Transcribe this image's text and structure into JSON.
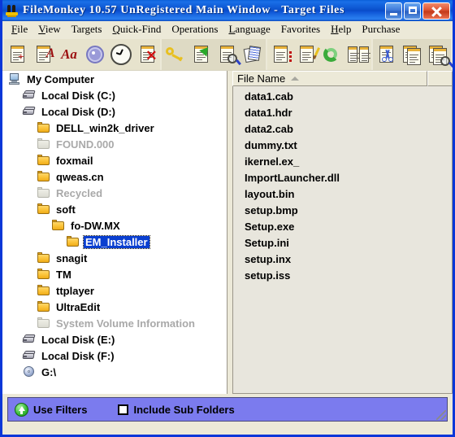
{
  "window": {
    "title": "FileMonkey 10.57 UnRegistered Main Window - Target Files",
    "app_icon": "monkey-icon",
    "minimize_label": "",
    "maximize_label": "",
    "close_label": ""
  },
  "menubar": {
    "items": [
      {
        "label": "File",
        "accel": "F"
      },
      {
        "label": "View",
        "accel": "V"
      },
      {
        "label": "Targets",
        "accel": "T"
      },
      {
        "label": "Quick-Find",
        "accel": "Q"
      },
      {
        "label": "Operations",
        "accel": "O"
      },
      {
        "label": "Language",
        "accel": "L"
      },
      {
        "label": "Favorites",
        "accel": "F"
      },
      {
        "label": "Help",
        "accel": "H"
      },
      {
        "label": "Purchase",
        "accel": ""
      }
    ]
  },
  "toolbar": {
    "buttons": [
      {
        "name": "add-files-icon"
      },
      {
        "name": "rename-text-icon"
      },
      {
        "name": "change-case-icon"
      },
      {
        "name": "properties-gear-icon"
      },
      {
        "name": "timestamps-clock-icon"
      },
      {
        "name": "delete-files-icon"
      },
      {
        "name": "attributes-key-icon"
      },
      {
        "name": "move-files-icon"
      },
      {
        "name": "find-in-files-icon"
      },
      {
        "name": "duplicate-files-icon"
      },
      {
        "name": "list-files-icon"
      },
      {
        "name": "edit-files-icon"
      },
      {
        "name": "refresh-icon"
      },
      {
        "name": "compare-files-icon"
      },
      {
        "name": "cut-split-icon"
      },
      {
        "name": "merge-files-icon"
      },
      {
        "name": "search-files-icon"
      }
    ]
  },
  "tree": {
    "nodes": [
      {
        "label": "My Computer",
        "icon": "computer-icon",
        "indent": 0,
        "dim": false,
        "selected": false
      },
      {
        "label": "Local Disk (C:)",
        "icon": "disk-icon",
        "indent": 1,
        "dim": false,
        "selected": false
      },
      {
        "label": "Local Disk (D:)",
        "icon": "disk-icon",
        "indent": 1,
        "dim": false,
        "selected": false
      },
      {
        "label": "DELL_win2k_driver",
        "icon": "folder-icon",
        "indent": 2,
        "dim": false,
        "selected": false
      },
      {
        "label": "FOUND.000",
        "icon": "folder-icon",
        "indent": 2,
        "dim": true,
        "selected": false
      },
      {
        "label": "foxmail",
        "icon": "folder-icon",
        "indent": 2,
        "dim": false,
        "selected": false
      },
      {
        "label": "qweas.cn",
        "icon": "folder-icon",
        "indent": 2,
        "dim": false,
        "selected": false
      },
      {
        "label": "Recycled",
        "icon": "folder-icon",
        "indent": 2,
        "dim": true,
        "selected": false
      },
      {
        "label": "soft",
        "icon": "folder-icon",
        "indent": 2,
        "dim": false,
        "selected": false
      },
      {
        "label": "fo-DW.MX",
        "icon": "folder-icon",
        "indent": 3,
        "dim": false,
        "selected": false
      },
      {
        "label": "EM_Installer",
        "icon": "folder-icon",
        "indent": 4,
        "dim": false,
        "selected": true
      },
      {
        "label": "snagit",
        "icon": "folder-icon",
        "indent": 2,
        "dim": false,
        "selected": false
      },
      {
        "label": "TM",
        "icon": "folder-icon",
        "indent": 2,
        "dim": false,
        "selected": false
      },
      {
        "label": "ttplayer",
        "icon": "folder-icon",
        "indent": 2,
        "dim": false,
        "selected": false
      },
      {
        "label": "UltraEdit",
        "icon": "folder-icon",
        "indent": 2,
        "dim": false,
        "selected": false
      },
      {
        "label": "System Volume Information",
        "icon": "folder-icon",
        "indent": 2,
        "dim": true,
        "selected": false
      },
      {
        "label": "Local Disk (E:)",
        "icon": "disk-icon",
        "indent": 1,
        "dim": false,
        "selected": false
      },
      {
        "label": "Local Disk (F:)",
        "icon": "disk-icon",
        "indent": 1,
        "dim": false,
        "selected": false
      },
      {
        "label": "G:\\",
        "icon": "cd-icon",
        "indent": 1,
        "dim": false,
        "selected": false
      }
    ]
  },
  "filelist": {
    "columns": [
      {
        "label": "File Name",
        "sorted": "asc"
      },
      {
        "label": ""
      }
    ],
    "rows": [
      {
        "name": "data1.cab"
      },
      {
        "name": "data1.hdr"
      },
      {
        "name": "data2.cab"
      },
      {
        "name": "dummy.txt"
      },
      {
        "name": "ikernel.ex_"
      },
      {
        "name": "ImportLauncher.dll"
      },
      {
        "name": "layout.bin"
      },
      {
        "name": "setup.bmp"
      },
      {
        "name": "Setup.exe"
      },
      {
        "name": "Setup.ini"
      },
      {
        "name": "setup.inx"
      },
      {
        "name": "setup.iss"
      }
    ]
  },
  "filterbar": {
    "use_filters_label": "Use Filters",
    "use_filters_icon": "green-up-arrow-icon",
    "include_sub_folders_label": "Include Sub Folders",
    "include_sub_folders_checked": false,
    "background_color": "#7b7bee"
  },
  "colors": {
    "titlebar": "#0a55d0",
    "window_border": "#0a37d8",
    "chrome": "#ece9d8",
    "selection": "#0a3fd0",
    "list_background": "#e8e6dd"
  }
}
